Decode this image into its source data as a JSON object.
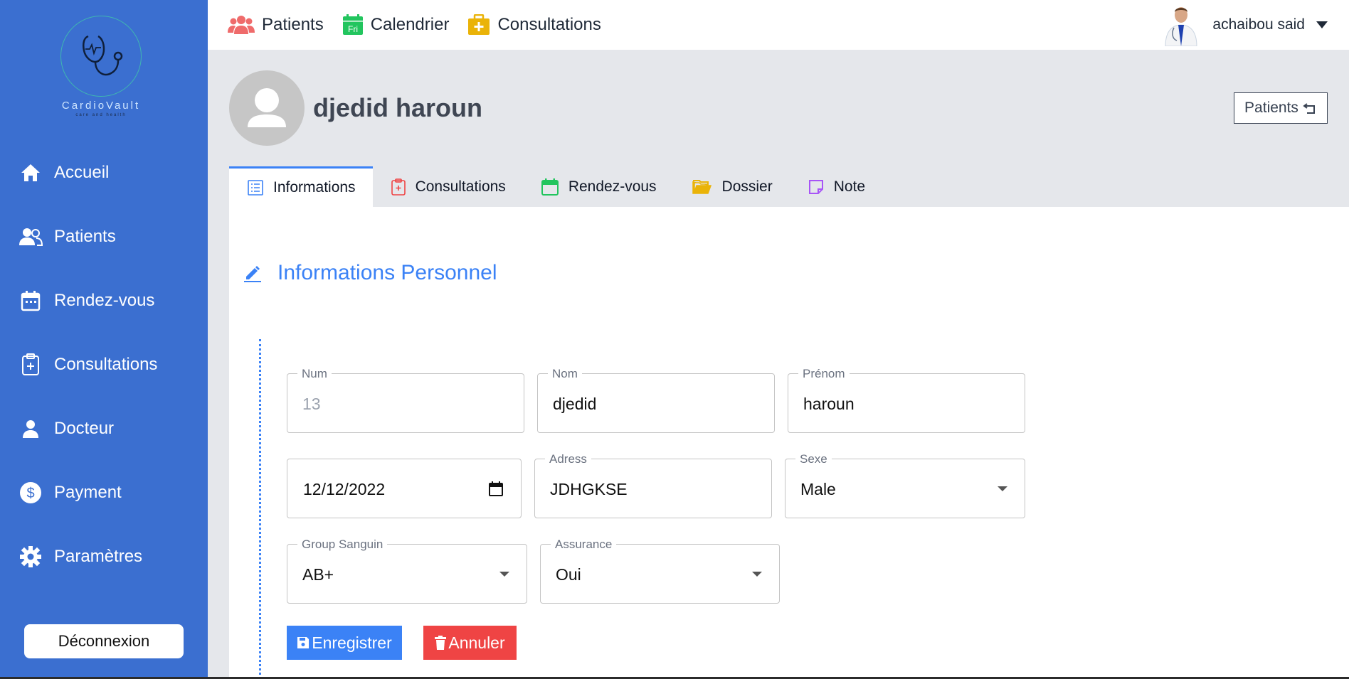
{
  "brand": {
    "name": "CardioVault",
    "tagline": "care and health"
  },
  "sidebar": {
    "items": [
      {
        "label": "Accueil",
        "icon": "home-icon"
      },
      {
        "label": "Patients",
        "icon": "users-icon"
      },
      {
        "label": "Rendez-vous",
        "icon": "calendar-icon"
      },
      {
        "label": "Consultations",
        "icon": "clipboard-plus-icon"
      },
      {
        "label": "Docteur",
        "icon": "user-icon"
      },
      {
        "label": "Payment",
        "icon": "dollar-icon"
      },
      {
        "label": "Paramètres",
        "icon": "gear-icon"
      }
    ],
    "logout_label": "Déconnexion"
  },
  "topnav": {
    "items": [
      {
        "label": "Patients",
        "icon": "users-icon",
        "color": "#ef6b6b"
      },
      {
        "label": "Calendrier",
        "icon": "calendar-fri-icon",
        "color": "#22c55e",
        "icon_text": "Fri"
      },
      {
        "label": "Consultations",
        "icon": "medical-bag-icon",
        "color": "#eab308"
      }
    ],
    "user_name": "achaibou said"
  },
  "patient": {
    "name": "djedid haroun",
    "back_label": "Patients"
  },
  "tabs": [
    {
      "label": "Informations",
      "icon": "list-icon",
      "color": "#3b82f6",
      "active": true
    },
    {
      "label": "Consultations",
      "icon": "clipboard-plus-icon",
      "color": "#ef4444"
    },
    {
      "label": "Rendez-vous",
      "icon": "calendar-icon",
      "color": "#22c55e"
    },
    {
      "label": "Dossier",
      "icon": "folder-open-icon",
      "color": "#eab308"
    },
    {
      "label": "Note",
      "icon": "sticky-note-icon",
      "color": "#a855f7"
    }
  ],
  "section": {
    "title": "Informations Personnel"
  },
  "form": {
    "num": {
      "label": "Num",
      "value": "13"
    },
    "nom": {
      "label": "Nom",
      "value": "djedid"
    },
    "prenom": {
      "label": "Prénom",
      "value": "haroun"
    },
    "date": {
      "value": "12/12/2022"
    },
    "adress": {
      "label": "Adress",
      "value": "JDHGKSE"
    },
    "sexe": {
      "label": "Sexe",
      "value": "Male"
    },
    "group": {
      "label": "Group Sanguin",
      "value": "AB+"
    },
    "assurance": {
      "label": "Assurance",
      "value": "Oui"
    }
  },
  "actions": {
    "save_label": "Enregistrer",
    "cancel_label": "Annuler"
  }
}
